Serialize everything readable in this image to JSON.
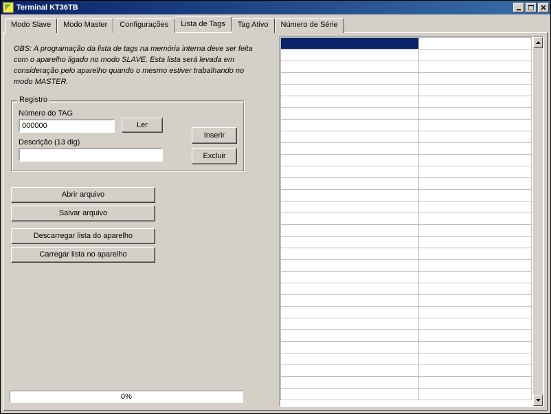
{
  "window": {
    "title": "Terminal KT36TB"
  },
  "tabs": [
    {
      "label": "Modo Slave"
    },
    {
      "label": "Modo Master"
    },
    {
      "label": "Configurações"
    },
    {
      "label": "Lista de Tags"
    },
    {
      "label": "Tag Ativo"
    },
    {
      "label": "Número de Série"
    }
  ],
  "active_tab_index": 3,
  "obs_text": "OBS: A programação da lista de tags na memória interna deve ser feita com o aparelho ligado no modo SLAVE. Esta lista será levada em consideração pelo aparelho quando o mesmo estiver trabalhando no modo MASTER.",
  "registro": {
    "group_label": "Registro",
    "tag_label": "Número do TAG",
    "tag_value": "000000",
    "ler_label": "Ler",
    "desc_label": "Descrição (13 dig)",
    "desc_value": "",
    "inserir_label": "Inserir",
    "excluir_label": "Excluir"
  },
  "buttons": {
    "abrir": "Abrir arquivo",
    "salvar": "Salvar arquivo",
    "descarregar": "Descarregar lista do aparelho",
    "carregar": "Carregar lista no aparelho"
  },
  "progress": {
    "text": "0%"
  },
  "grid": {
    "rows": 31,
    "selected_row": 0
  }
}
